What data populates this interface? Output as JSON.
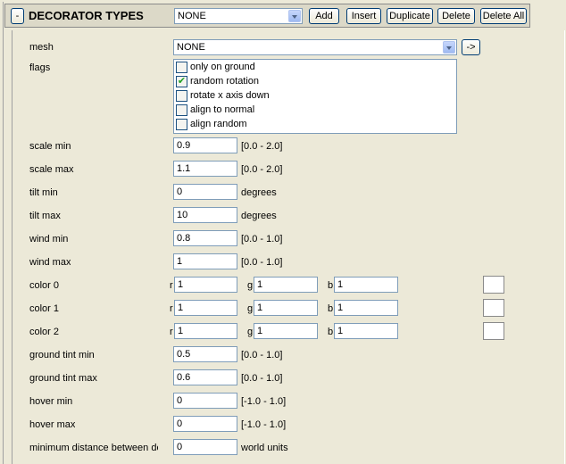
{
  "header": {
    "collapse_label": "-",
    "title": "DECORATOR TYPES",
    "selected_type": "NONE",
    "buttons": {
      "add": "Add",
      "insert": "Insert",
      "duplicate": "Duplicate",
      "delete": "Delete",
      "delete_all": "Delete All"
    }
  },
  "mesh": {
    "label": "mesh",
    "value": "NONE",
    "browse_label": "->"
  },
  "flags": {
    "label": "flags",
    "items": [
      {
        "label": "only on ground",
        "checked": false
      },
      {
        "label": "random rotation",
        "checked": true
      },
      {
        "label": "rotate x axis down",
        "checked": false
      },
      {
        "label": "align to normal",
        "checked": false
      },
      {
        "label": "align random",
        "checked": false
      }
    ]
  },
  "fields": {
    "scale_min": {
      "label": "scale min",
      "value": "0.9",
      "hint": "[0.0 - 2.0]"
    },
    "scale_max": {
      "label": "scale max",
      "value": "1.1",
      "hint": "[0.0 - 2.0]"
    },
    "tilt_min": {
      "label": "tilt min",
      "value": "0",
      "hint": "degrees"
    },
    "tilt_max": {
      "label": "tilt max",
      "value": "10",
      "hint": "degrees"
    },
    "wind_min": {
      "label": "wind min",
      "value": "0.8",
      "hint": "[0.0 - 1.0]"
    },
    "wind_max": {
      "label": "wind max",
      "value": "1",
      "hint": "[0.0 - 1.0]"
    },
    "ground_tint_min": {
      "label": "ground tint min",
      "value": "0.5",
      "hint": "[0.0 - 1.0]"
    },
    "ground_tint_max": {
      "label": "ground tint max",
      "value": "0.6",
      "hint": "[0.0 - 1.0]"
    },
    "hover_min": {
      "label": "hover min",
      "value": "0",
      "hint": "[-1.0 - 1.0]"
    },
    "hover_max": {
      "label": "hover max",
      "value": "0",
      "hint": "[-1.0 - 1.0]"
    },
    "min_distance": {
      "label": "minimum distance between decorators",
      "value": "0",
      "hint": "world units"
    }
  },
  "colors": [
    {
      "label": "color 0",
      "r_label": "r",
      "g_label": "g",
      "b_label": "b",
      "r": "1",
      "g": "1",
      "b": "1",
      "swatch": "#ffffff"
    },
    {
      "label": "color 1",
      "r_label": "r",
      "g_label": "g",
      "b_label": "b",
      "r": "1",
      "g": "1",
      "b": "1",
      "swatch": "#ffffff"
    },
    {
      "label": "color 2",
      "r_label": "r",
      "g_label": "g",
      "b_label": "b",
      "r": "1",
      "g": "1",
      "b": "1",
      "swatch": "#ffffff"
    }
  ],
  "theme": {
    "panel_bg": "#ece9d8",
    "header_border": "#7f7f7f",
    "field_border": "#7f9db9",
    "check_color": "#21a121"
  }
}
